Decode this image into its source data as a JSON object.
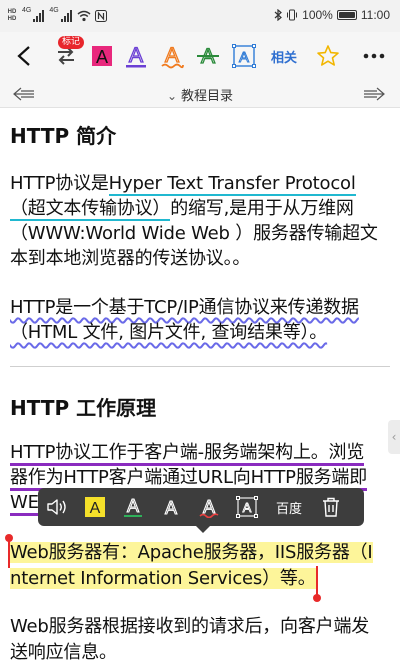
{
  "status_bar": {
    "net_labels": [
      "HD",
      "HD"
    ],
    "sig_labels": [
      "4G",
      "4G"
    ],
    "battery": "100%",
    "time": "11:00"
  },
  "toolbar": {
    "badge": "标记",
    "related": "相关",
    "colors": {
      "pink": "#e8287c",
      "purple": "#6b3fd4",
      "orange": "#f07a1e",
      "green": "#2a8a3a",
      "blue": "#2f7bd6",
      "star": "#f2b600"
    }
  },
  "nav": {
    "title": "教程目录"
  },
  "article": {
    "h1": "HTTP 简介",
    "p1": [
      "HTTP协议是",
      "Hyper Text Transfer Protocol",
      "（超文本传输协议）",
      "的缩写,是用于从万维网",
      "（WWW:World Wide Web ）服务器传输超文",
      "本到本地浏览器的传送协议。。"
    ],
    "p2": [
      "HTTP是一个基于TCP/IP通信协议来传递数据",
      "（HTML 文件, 图片文件, 查询结果等）。"
    ],
    "h2": "HTTP 工作原理",
    "p3": [
      "HTTP协议工作于客户端-服务端架构上。浏览",
      "器作为HTTP客户端通过URL向HTTP服务端即",
      "WEB"
    ],
    "p4": [
      "Web服务器有：Apache服务器，IIS服务器（I",
      "nternet Information Services）等。"
    ],
    "p5": [
      "Web服务器根据接收到的请求后，向客户端发",
      "送响应信息。"
    ]
  },
  "float_menu": {
    "baidu": "百度"
  }
}
